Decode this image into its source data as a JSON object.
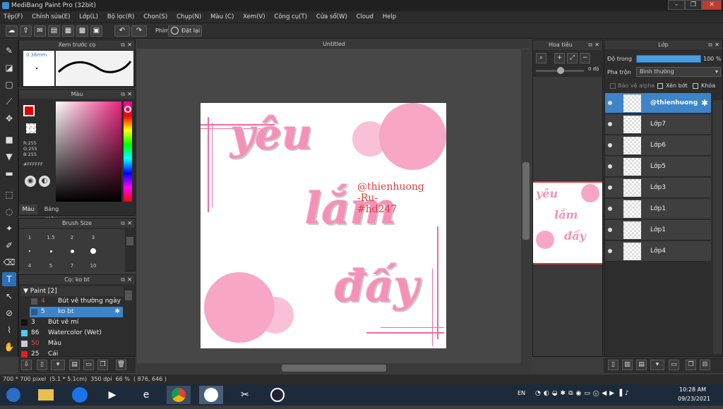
{
  "window": {
    "title": "MediBang Paint Pro (32bit)"
  },
  "menu": [
    "Tệp(F)",
    "Chỉnh sửa(E)",
    "Lớp(L)",
    "Bộ lọc(R)",
    "Chọn(S)",
    "Chụp(N)",
    "Màu (C)",
    "Xem(V)",
    "Công cụ(T)",
    "Cửa sổ(W)",
    "Cloud",
    "Help"
  ],
  "toolbar": {
    "keys_label": "Phím",
    "reset_label": "Đặt lại"
  },
  "brush_preview": {
    "title": "Xem trước cọ",
    "size": "0.36mm"
  },
  "color_panel": {
    "title": "Màu",
    "r": "R:255",
    "g": "G:255",
    "b": "B:255",
    "hex": "#FFFFFF",
    "tab_color": "Màu",
    "tab_palette": "Bảng màu",
    "colors": {
      "main": "#e00000",
      "hue_top": "#ff00aa"
    }
  },
  "brush_size": {
    "title": "Brush Size",
    "sizes": [
      "1",
      "1.5",
      "2",
      "3",
      "4",
      "5",
      "7",
      "10"
    ]
  },
  "brush_panel": {
    "title": "Cọ: ko bt",
    "group": "Paint [2]",
    "items": [
      {
        "num": "4",
        "name": "Bút vẽ thường ngày",
        "color": "#555555",
        "numcolor": "#e05050"
      },
      {
        "num": "5",
        "name": "ko bt",
        "color": "#2a5a8a",
        "numcolor": "#ffffff",
        "selected": true
      },
      {
        "num": "3",
        "name": "Bút vẽ mí",
        "color": "#111111",
        "numcolor": "#eeeeee"
      },
      {
        "num": "86",
        "name": "Watercolor (Wet)",
        "color": "#5ac8f5",
        "numcolor": "#eeeeee"
      },
      {
        "num": "50",
        "name": "Màu",
        "color": "#cccccc",
        "numcolor": "#e05050"
      },
      {
        "num": "25",
        "name": "Cái",
        "color": "#e02020",
        "numcolor": "#eeeeee"
      }
    ]
  },
  "canvas": {
    "tab_title": "Untitled",
    "texts": {
      "yeu": "yêu",
      "lam": "lắm",
      "day": "đấy",
      "line1": "@thienhuong",
      "line2": "-Ru-",
      "line3": "#hd247"
    }
  },
  "navigator": {
    "title": "Hoa tiêu",
    "rotation": "0 độ"
  },
  "layer_panel": {
    "title": "Lớp",
    "opacity_label": "Độ trong",
    "opacity_value": "100 %",
    "blend_label": "Pha trộn",
    "blend_value": "Bình thường",
    "protect_alpha": "Bảo vệ alpha",
    "clipping": "Xén bớt",
    "lock": "Khóa",
    "layers": [
      {
        "name": "@thienhuong",
        "selected": true
      },
      {
        "name": "Lớp7"
      },
      {
        "name": "Lớp6"
      },
      {
        "name": "Lớp5"
      },
      {
        "name": "Lớp3"
      },
      {
        "name": "Lớp1"
      },
      {
        "name": "Lớp1"
      },
      {
        "name": "Lớp4"
      }
    ]
  },
  "status": {
    "size": "700 * 700 pixel",
    "cm": "(5.1 * 5.1cm)",
    "dpi": "350 dpi",
    "zoom": "66 %",
    "cursor": "( 876, 646 )"
  },
  "taskbar": {
    "lang": "EN",
    "time": "10:28 AM",
    "date": "09/23/2021"
  }
}
